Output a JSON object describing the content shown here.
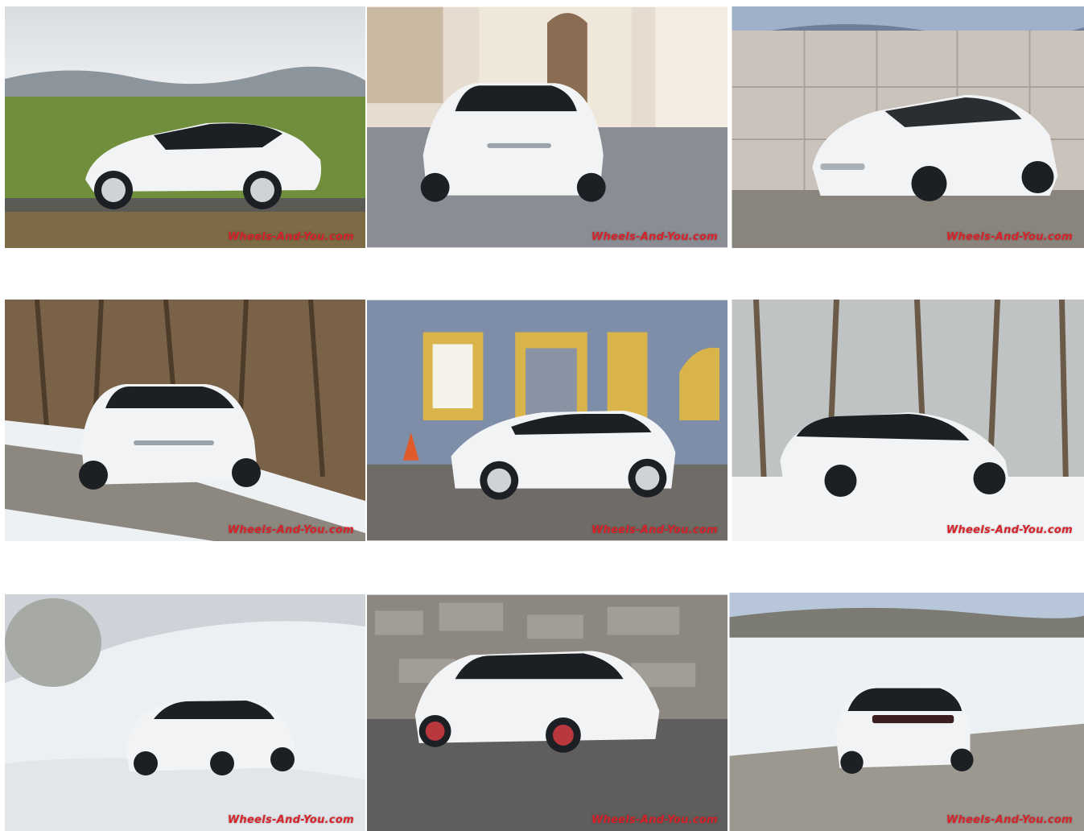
{
  "gallery": {
    "watermark_text": "Wheels-And-You.com",
    "photos": [
      {
        "scene": "side view on green field"
      },
      {
        "scene": "front three-quarter in old town street"
      },
      {
        "scene": "front view by concrete blocks"
      },
      {
        "scene": "front three-quarter on snowy road with bare trees"
      },
      {
        "scene": "side view in front of blue-grey building"
      },
      {
        "scene": "rear three-quarter on snowy field"
      },
      {
        "scene": "front three-quarter in snowy meadow"
      },
      {
        "scene": "driving past stone wall"
      },
      {
        "scene": "rear view drifting on snowy road"
      }
    ]
  },
  "colors": {
    "watermark": "#d8232a",
    "car_body": "#f2f3f4",
    "car_roof": "#1c1f24"
  }
}
